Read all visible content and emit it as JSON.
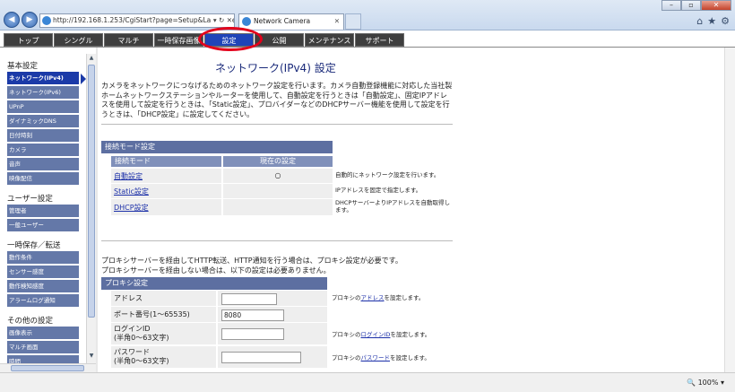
{
  "browser": {
    "url": "http://192.168.1.253/CgiStart?page=Setup&Language=1",
    "tab_title": "Network Camera",
    "zoom": "100%"
  },
  "nav": {
    "tabs": [
      {
        "label": "トップ"
      },
      {
        "label": "シングル"
      },
      {
        "label": "マルチ"
      },
      {
        "label": "一時保存画像"
      },
      {
        "label": "設定"
      },
      {
        "label": "公開"
      },
      {
        "label": "メンテナンス"
      },
      {
        "label": "サポート"
      }
    ],
    "active": "設定"
  },
  "sidebar": {
    "groups": [
      {
        "title": "基本設定",
        "items": [
          "ネットワーク(IPv4)",
          "ネットワーク(IPv6)",
          "UPnP",
          "ダイナミックDNS",
          "日付時刻",
          "カメラ",
          "音声",
          "映像配信"
        ]
      },
      {
        "title": "ユーザー設定",
        "items": [
          "管理者",
          "一般ユーザー"
        ]
      },
      {
        "title": "一時保存／転送",
        "items": [
          "動作条件",
          "センサー感度",
          "動作検知感度",
          "アラームログ通知"
        ]
      },
      {
        "title": "その他の設定",
        "items": [
          "画像表示",
          "マルチ画面",
          "時間"
        ]
      }
    ]
  },
  "main": {
    "title": "ネットワーク(IPv4) 設定",
    "intro": "カメラをネットワークにつなげるためのネットワーク設定を行います。カメラ自動登録機能に対応した当社製ホームネットワークステーションやルーターを使用して、自動設定を行うときは「自動設定」、固定IPアドレスを使用して設定を行うときは、「Static設定」、プロバイダーなどのDHCPサーバー機能を使用して設定を行うときは、「DHCP設定」に設定してください。",
    "connection": {
      "header": "接続モード設定",
      "col_mode": "接続モード",
      "col_current": "現在の設定",
      "rows": [
        {
          "mode": "自動設定",
          "current": "○",
          "desc": "自動的にネットワーク設定を行います。"
        },
        {
          "mode": "Static設定",
          "current": "",
          "desc": "IPアドレスを固定で指定します。"
        },
        {
          "mode": "DHCP設定",
          "current": "",
          "desc": "DHCPサーバーよりIPアドレスを自動取得します。"
        }
      ]
    },
    "proxy_intro_1": "プロキシサーバーを経由してHTTP転送、HTTP通知を行う場合は、プロキシ設定が必要です。",
    "proxy_intro_2": "プロキシサーバーを経由しない場合は、以下の設定は必要ありません。",
    "proxy": {
      "header": "プロキシ設定",
      "rows": [
        {
          "label": "アドレス",
          "value": "",
          "desc_pre": "プロキシの",
          "desc_link": "アドレス",
          "desc_post": "を設定します。"
        },
        {
          "label": "ポート番号(1～65535)",
          "value": "8080",
          "desc_pre": "",
          "desc_link": "",
          "desc_post": ""
        },
        {
          "label": "ログインID\n(半角0～63文字)",
          "value": "",
          "desc_pre": "プロキシの",
          "desc_link": "ログインID",
          "desc_post": "を設定します。"
        },
        {
          "label": "パスワード\n(半角0～63文字)",
          "value": "",
          "desc_pre": "プロキシの",
          "desc_link": "パスワード",
          "desc_post": "を設定します。"
        }
      ]
    }
  }
}
